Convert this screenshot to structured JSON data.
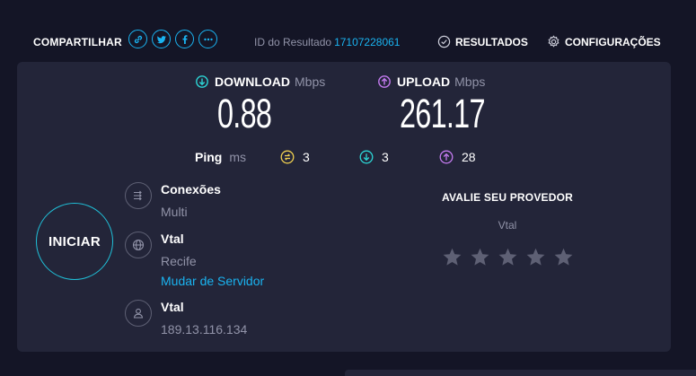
{
  "topbar": {
    "share_label": "COMPARTILHAR",
    "share_icons": [
      "link-icon",
      "twitter-icon",
      "facebook-icon",
      "more-icon"
    ],
    "result_id_label": "ID do Resultado",
    "result_id": "17107228061",
    "results_label": "RESULTADOS",
    "settings_label": "CONFIGURAÇÕES"
  },
  "download": {
    "label": "DOWNLOAD",
    "unit": "Mbps",
    "value": "0.88"
  },
  "upload": {
    "label": "UPLOAD",
    "unit": "Mbps",
    "value": "261.17"
  },
  "ping": {
    "label": "Ping",
    "unit": "ms",
    "idle": "3",
    "download": "3",
    "upload": "28"
  },
  "start_button": {
    "label": "INICIAR"
  },
  "connections": {
    "title": "Conexões",
    "value": "Multi"
  },
  "server": {
    "name": "Vtal",
    "location": "Recife",
    "change_link": "Mudar de Servidor"
  },
  "client": {
    "provider": "Vtal",
    "ip": "189.13.116.134"
  },
  "rating": {
    "title": "AVALIE SEU PROVEDOR",
    "provider": "Vtal",
    "stars_total": 5,
    "stars_selected": 0
  },
  "colors": {
    "background": "#141526",
    "panel": "#232539",
    "accent_blue": "#1ab3f0",
    "download": "#2cd6d6",
    "upload": "#c47bf0",
    "ping_idle": "#f0d050",
    "muted": "#9193a8"
  }
}
